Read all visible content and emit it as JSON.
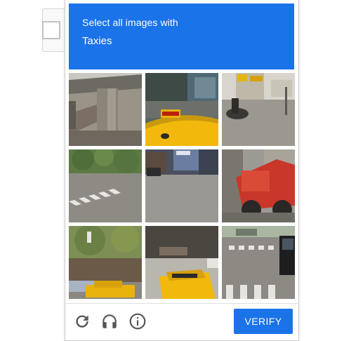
{
  "challenge": {
    "instruction": "Select all images with",
    "target_object": "Taxies"
  },
  "tiles": [
    {
      "row": 1,
      "col": 1,
      "scene": "highway overpass"
    },
    {
      "row": 1,
      "col": 2,
      "scene": "taxi roof"
    },
    {
      "row": 1,
      "col": 3,
      "scene": "street corner with motorcycle"
    },
    {
      "row": 2,
      "col": 1,
      "scene": "road crossing with trees"
    },
    {
      "row": 2,
      "col": 2,
      "scene": "storefront street"
    },
    {
      "row": 2,
      "col": 3,
      "scene": "red construction vehicle"
    },
    {
      "row": 3,
      "col": 1,
      "scene": "street with trees and taxi"
    },
    {
      "row": 3,
      "col": 2,
      "scene": "taxi on street"
    },
    {
      "row": 3,
      "col": 3,
      "scene": "crosswalk with black car"
    }
  ],
  "footer": {
    "reload_icon": "reload-icon",
    "audio_icon": "headphones-icon",
    "info_icon": "info-icon",
    "verify_label": "VERIFY"
  },
  "colors": {
    "accent": "#1a73e8",
    "taxi_yellow": "#f2b90c"
  }
}
